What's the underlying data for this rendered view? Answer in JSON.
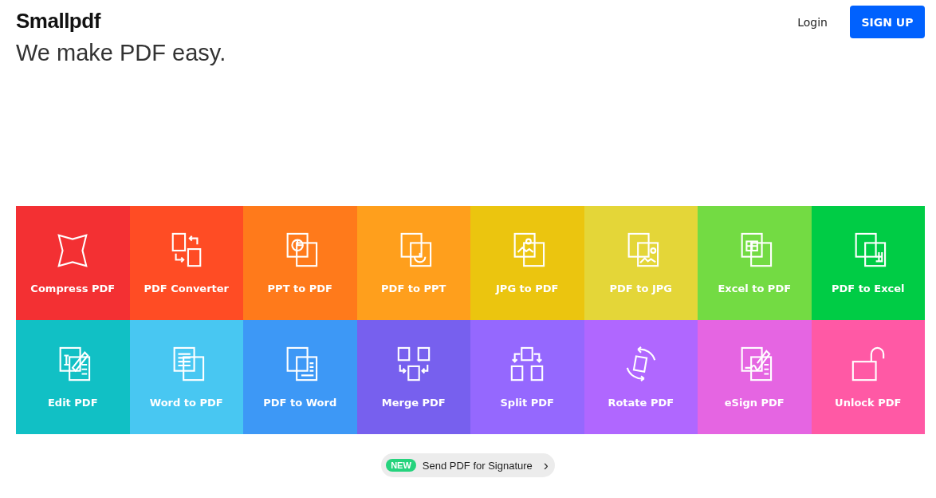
{
  "header": {
    "logo": "Smallpdf",
    "login": "Login",
    "signup": "SIGN UP"
  },
  "tagline": "We make PDF easy.",
  "tools": [
    {
      "label": "Compress PDF",
      "kind": "compress",
      "color": "#f33033"
    },
    {
      "label": "PDF Converter",
      "kind": "convert",
      "color": "#ff4c24"
    },
    {
      "label": "PPT to PDF",
      "kind": "ppt",
      "color": "#ff7a1b"
    },
    {
      "label": "PDF to PPT",
      "kind": "toppt",
      "color": "#ff9f1c"
    },
    {
      "label": "JPG to PDF",
      "kind": "jpg",
      "color": "#ebc50f"
    },
    {
      "label": "PDF to JPG",
      "kind": "tojpg",
      "color": "#e4d638"
    },
    {
      "label": "Excel to PDF",
      "kind": "excel",
      "color": "#73db43"
    },
    {
      "label": "PDF to Excel",
      "kind": "toexcel",
      "color": "#00cc45"
    },
    {
      "label": "Edit PDF",
      "kind": "edit",
      "color": "#11c0c5"
    },
    {
      "label": "Word to PDF",
      "kind": "word",
      "color": "#48c7f2"
    },
    {
      "label": "PDF to Word",
      "kind": "toword",
      "color": "#3d98f6"
    },
    {
      "label": "Merge PDF",
      "kind": "merge",
      "color": "#7760ee"
    },
    {
      "label": "Split PDF",
      "kind": "split",
      "color": "#9568fe"
    },
    {
      "label": "Rotate PDF",
      "kind": "rotate",
      "color": "#b067ff"
    },
    {
      "label": "eSign PDF",
      "kind": "esign",
      "color": "#e565e2"
    },
    {
      "label": "Unlock PDF",
      "kind": "unlock",
      "color": "#ff59a5"
    }
  ],
  "promo": {
    "badge": "NEW",
    "text": "Send PDF for Signature",
    "chevron": "›"
  }
}
